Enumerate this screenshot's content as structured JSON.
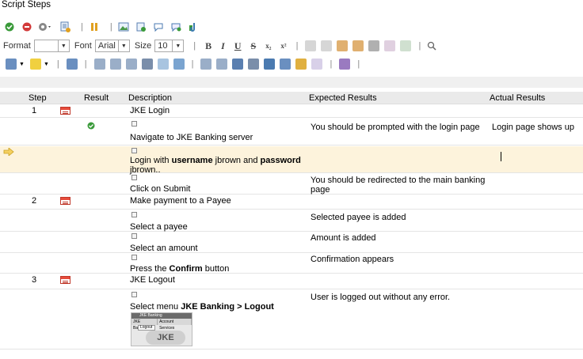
{
  "title": "Script Steps",
  "toolbar2": {
    "format_label": "Format",
    "format_value": "",
    "font_label": "Font",
    "font_value": "Arial",
    "size_label": "Size",
    "size_value": "10"
  },
  "table": {
    "headers": {
      "step": "Step",
      "result": "Result",
      "description": "Description",
      "expected": "Expected Results",
      "actual": "Actual Results"
    }
  },
  "rows": {
    "r1": {
      "step": "1",
      "description": "JKE Login"
    },
    "r2": {
      "description": "Navigate to JKE Banking server",
      "expected": "You should be prompted with the login page",
      "actual": "Login page shows up"
    },
    "r3": {
      "d1": "Login with ",
      "d2": "username",
      "d3": " jbrown and ",
      "d4": "password",
      "d5": "jbrown.."
    },
    "r4": {
      "description": "Click on Submit",
      "expected1": "You should be redirected to the main banking",
      "expected2": "page"
    },
    "r5": {
      "step": "2",
      "description": "Make payment to a Payee"
    },
    "r6": {
      "description": "Select a payee",
      "expected": "Selected payee is added"
    },
    "r7": {
      "description": "Select an amount",
      "expected": "Amount is added"
    },
    "r8": {
      "d1": "Press the ",
      "d2": "Confirm",
      "d3": " button",
      "expected": "Confirmation appears"
    },
    "r9": {
      "step": "3",
      "description": "JKE Logout"
    },
    "r10": {
      "d1": "Select menu ",
      "d2": "JKE Banking > Logout",
      "expected": "User is logged out without any error."
    }
  },
  "thumbnail": {
    "titlebar": "JKE Banking",
    "menu1": "JKE Banking",
    "menu2": "Account Services",
    "item": "Logout",
    "logo": "JKE"
  }
}
